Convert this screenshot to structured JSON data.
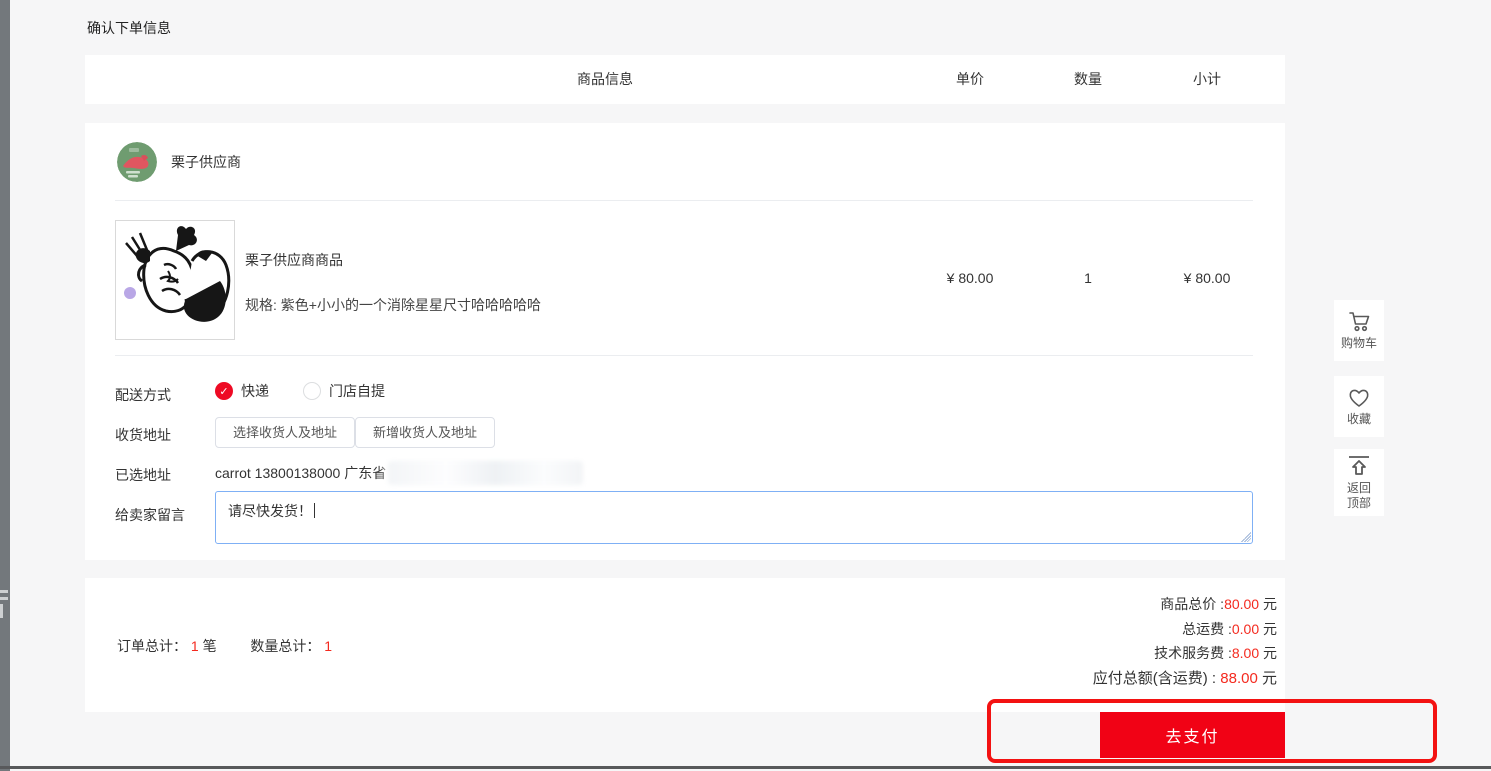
{
  "page": {
    "title": "确认下单信息"
  },
  "table": {
    "headers": [
      "商品信息",
      "单价",
      "数量",
      "小计"
    ]
  },
  "supplier": {
    "name": "栗子供应商"
  },
  "product": {
    "name": "栗子供应商商品",
    "spec": "规格: 紫色+小小的一个消除星星尺寸哈哈哈哈哈",
    "unit_price": "¥ 80.00",
    "quantity": "1",
    "subtotal": "¥ 80.00"
  },
  "form": {
    "delivery_label": "配送方式",
    "delivery_options": [
      {
        "label": "快递",
        "selected": true
      },
      {
        "label": "门店自提",
        "selected": false
      }
    ],
    "address_label": "收货地址",
    "select_address_button": "选择收货人及地址",
    "add_address_button": "新增收货人及地址",
    "selected_address_label": "已选地址",
    "selected_address_value": "carrot 13800138000 广东省",
    "message_label": "给卖家留言",
    "message_value": "请尽快发货！"
  },
  "summary": {
    "order_total_label": "订单总计：",
    "order_total_value": "1",
    "order_total_unit": "笔",
    "quantity_total_label": "数量总计：",
    "quantity_total_value": "1",
    "lines": [
      {
        "label": "商品总价 :",
        "value": "80.00",
        "unit": "元"
      },
      {
        "label": "总运费 :",
        "value": "0.00",
        "unit": "元"
      },
      {
        "label": "技术服务费 :",
        "value": "8.00",
        "unit": "元"
      },
      {
        "label": "应付总额(含运费) : ",
        "value": "88.00",
        "unit": "元"
      }
    ]
  },
  "pay": {
    "button_label": "去支付"
  },
  "float_sidebar": {
    "cart_label": "购物车",
    "favorite_label": "收藏",
    "back_to_top_line1": "返回",
    "back_to_top_line2": "顶部"
  },
  "colors": {
    "accent_red": "#f10215",
    "price_red": "#f42a1f",
    "focus_blue": "#7fb0f5",
    "annotation_red": "#f31212"
  }
}
